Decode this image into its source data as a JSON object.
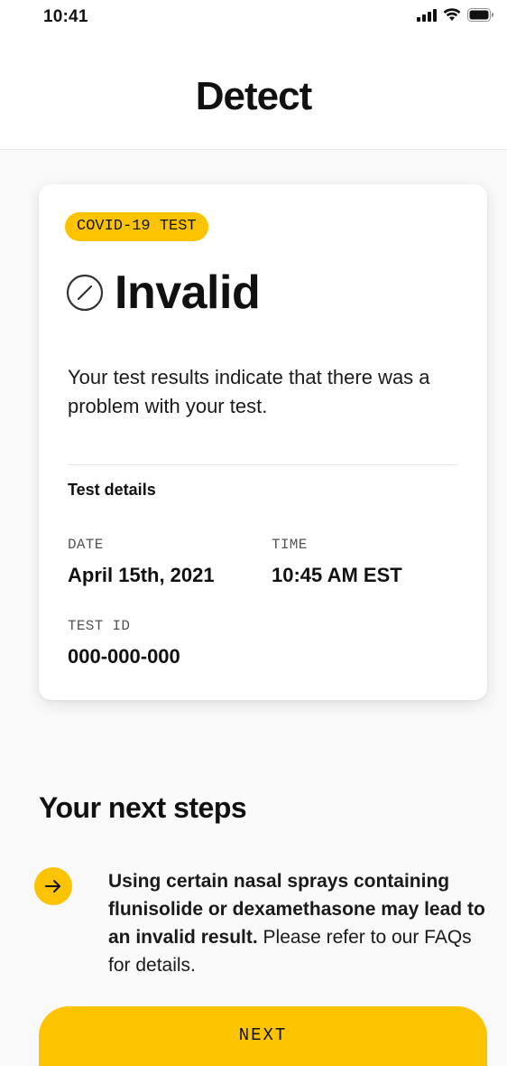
{
  "status_bar": {
    "time": "10:41"
  },
  "header": {
    "title": "Detect"
  },
  "result_card": {
    "tag": "COVID-19 TEST",
    "result": "Invalid",
    "description": "Your test results indicate that there was a problem with your test.",
    "details_heading": "Test details",
    "date_label": "DATE",
    "date_value": "April 15th, 2021",
    "time_label": "TIME",
    "time_value": "10:45 AM EST",
    "test_id_label": "TEST ID",
    "test_id_value": "000-000-000"
  },
  "next_steps": {
    "title": "Your next steps",
    "step1_bold": "Using certain nasal sprays containing flunisolide or dexamethasone may lead to an invalid result.",
    "step1_rest": " Please refer to our FAQs for details."
  },
  "footer": {
    "next_label": "NEXT"
  },
  "colors": {
    "accent": "#fcc400",
    "background": "#f9f9f9",
    "text": "#111111"
  },
  "icons": [
    "cellular-signal-icon",
    "wifi-icon",
    "battery-icon",
    "invalid-slash-circle-icon",
    "arrow-right-icon"
  ]
}
